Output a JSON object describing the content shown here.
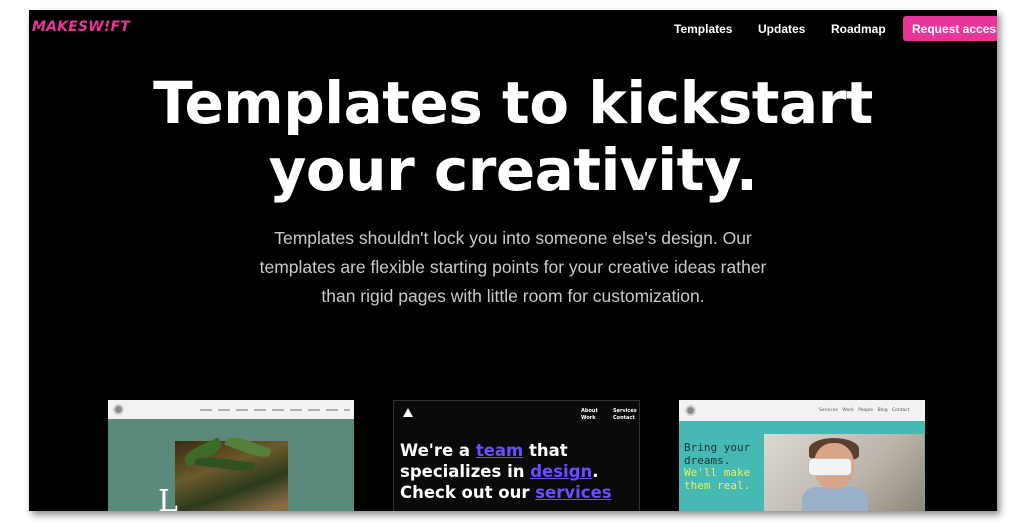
{
  "brand": {
    "name": "MAKESW!FT",
    "accent": "#e8359a"
  },
  "nav": {
    "links": [
      "Templates",
      "Updates",
      "Roadmap"
    ],
    "cta_label": "Request access"
  },
  "hero": {
    "title_line1": "Templates to kickstart",
    "title_line2": "your creativity.",
    "subtitle_line1": "Templates shouldn't lock you into someone else's design. Our",
    "subtitle_line2": "templates are flexible starting points for your creative ideas rather",
    "subtitle_line3": "than rigid pages with little room for customization."
  },
  "cards": [
    {
      "name": "template-card-1",
      "background": "#5a8a7c",
      "letter": "L"
    },
    {
      "name": "template-card-2",
      "nav_col1": "About\nWork",
      "nav_col2": "Services\nContact",
      "heading_pre": "We're a ",
      "heading_word1": "team",
      "heading_mid": " that specializes in ",
      "heading_word2": "design",
      "heading_post": ". Check out our ",
      "heading_word3": "services",
      "highlight_color": "#6a4dff"
    },
    {
      "name": "template-card-3",
      "nav_items": "Services Work People Blog Contact",
      "tagline_line1": "Bring your dreams.",
      "tagline_line2": "We'll make them real.",
      "background": "#47b9b4"
    }
  ]
}
